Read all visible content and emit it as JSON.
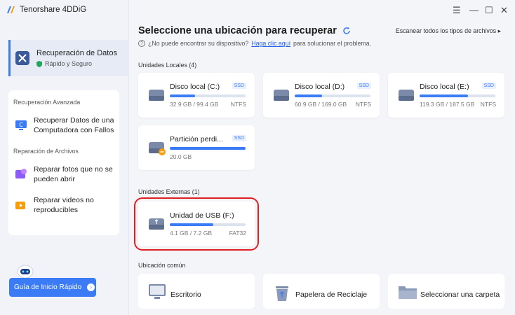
{
  "app": {
    "name": "Tenorshare 4DDiG"
  },
  "window_controls": {
    "menu": "☰",
    "minimize": "—",
    "maximize": "☐",
    "close": "✕"
  },
  "sidebar": {
    "main_item": {
      "title": "Recuperación de Datos",
      "subtitle": "Rápido y Seguro"
    },
    "advanced": {
      "section_title": "Recuperación Avanzada",
      "crash_item": "Recuperar Datos de una Computadora con Fallos"
    },
    "repair": {
      "section_title": "Reparación de Archivos",
      "photos_item": "Reparar fotos que no se pueden abrir",
      "videos_item": "Reparar videos no reproducibles"
    },
    "guide_button": "Guía de Inicio Rápido"
  },
  "main": {
    "title": "Seleccione una ubicación para recuperar",
    "scan_all": "Escanear todos los tipos de archivos",
    "help_text": "¿No puede encontrar su dispositivo?",
    "help_link": "Haga clic aquí",
    "help_suffix": "para solucionar el problema.",
    "local_label": "Unidades Locales (4)",
    "external_label": "Unidades Externas (1)",
    "common_label": "Ubicación común",
    "local_drives": [
      {
        "name": "Disco local (C:)",
        "badge": "SSD",
        "size": "32.9 GB / 99.4 GB",
        "fs": "NTFS",
        "used_fraction": 0.33
      },
      {
        "name": "Disco local (D:)",
        "badge": "SSD",
        "size": "60.9 GB / 169.0 GB",
        "fs": "NTFS",
        "used_fraction": 0.36
      },
      {
        "name": "Disco local (E:)",
        "badge": "SSD",
        "size": "119.3 GB / 187.5 GB",
        "fs": "NTFS",
        "used_fraction": 0.64
      },
      {
        "name": "Partición perdi...",
        "badge": "SSD",
        "size": "20.0 GB",
        "fs": "",
        "used_fraction": 1.0
      }
    ],
    "external_drives": [
      {
        "name": "Unidad de USB (F:)",
        "size": "4.1 GB / 7.2 GB",
        "fs": "FAT32",
        "used_fraction": 0.57
      }
    ],
    "common_locations": [
      {
        "label": "Escritorio",
        "icon": "desktop-icon"
      },
      {
        "label": "Papelera de Reciclaje",
        "icon": "recycle-bin-icon"
      },
      {
        "label": "Seleccionar una carpeta",
        "icon": "folder-icon"
      }
    ]
  },
  "colors": {
    "accent": "#3b7bf6",
    "highlight": "#e02020"
  }
}
